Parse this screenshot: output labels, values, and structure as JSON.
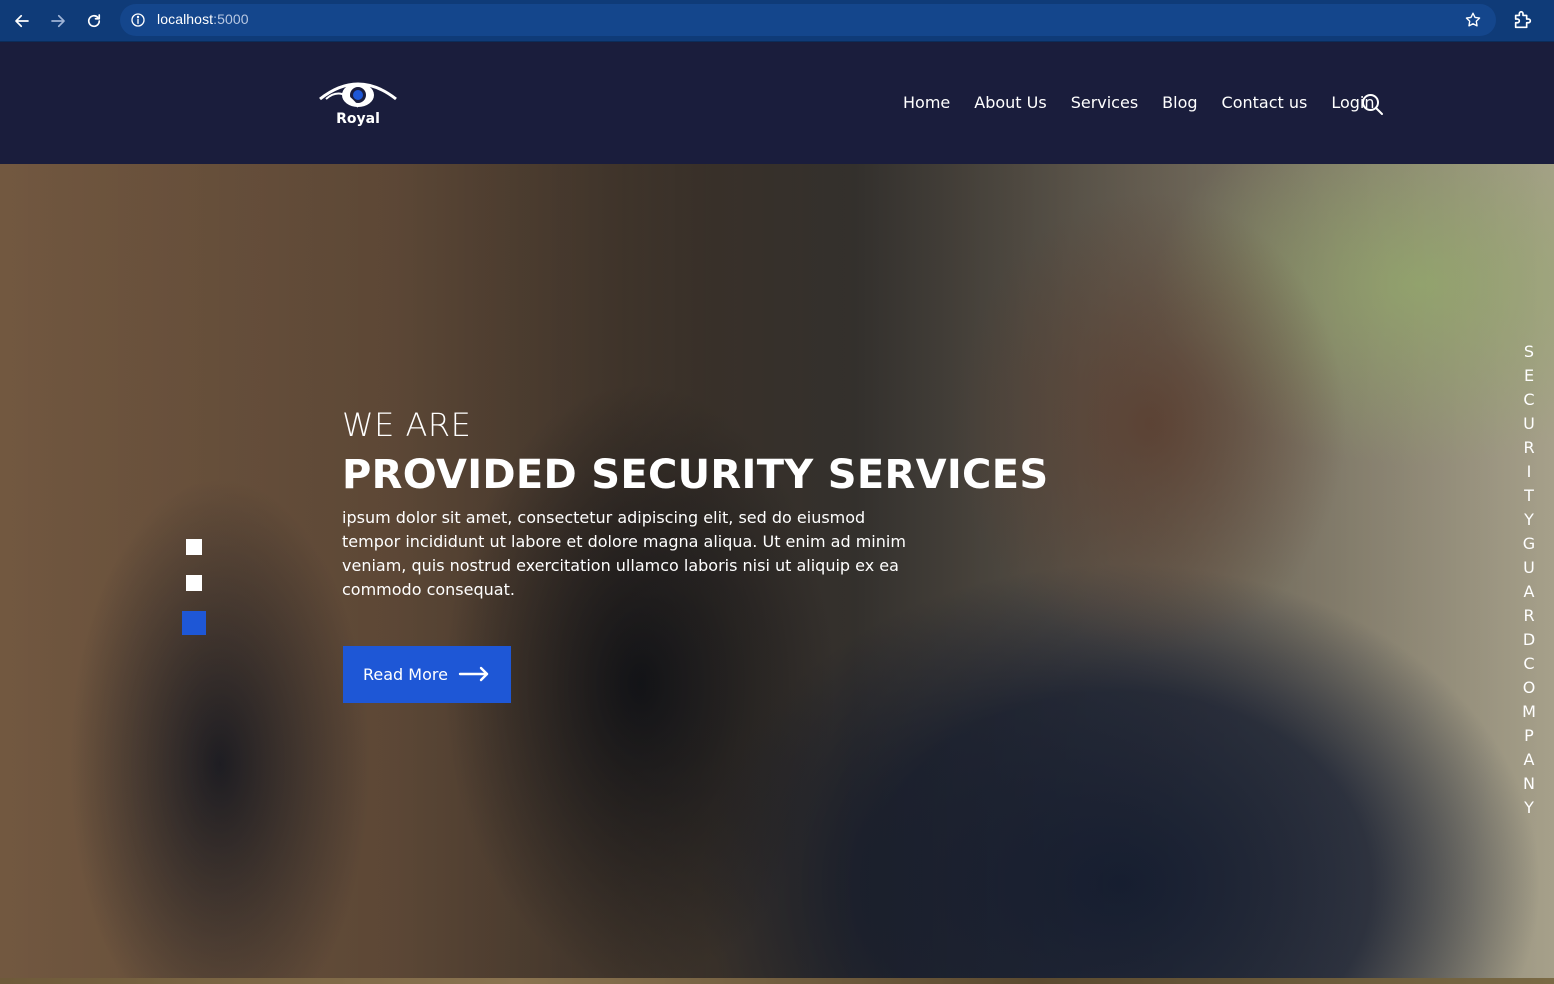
{
  "browser": {
    "url_host": "localhost",
    "url_port": ":5000"
  },
  "site": {
    "logo_text": "Royal",
    "nav": [
      "Home",
      "About Us",
      "Services",
      "Blog",
      "Contact us",
      "Login"
    ]
  },
  "hero": {
    "subtitle": "WE ARE",
    "title": "PROVIDED SECURITY SERVICES",
    "description": "ipsum dolor sit amet, consectetur adipiscing elit, sed do eiusmod tempor incididunt ut labore et dolore magna aliqua. Ut enim ad minim veniam, quis nostrud exercitation ullamco laboris nisi ut aliquip ex ea commodo consequat.",
    "button_label": "Read More",
    "side_text": "SECURITYGUARDCOMPANY",
    "active_slide": 3,
    "slide_count": 3
  },
  "colors": {
    "header_bg": "#1a1d3c",
    "accent": "#1e57d6",
    "browser_bar": "#0f3b78"
  }
}
